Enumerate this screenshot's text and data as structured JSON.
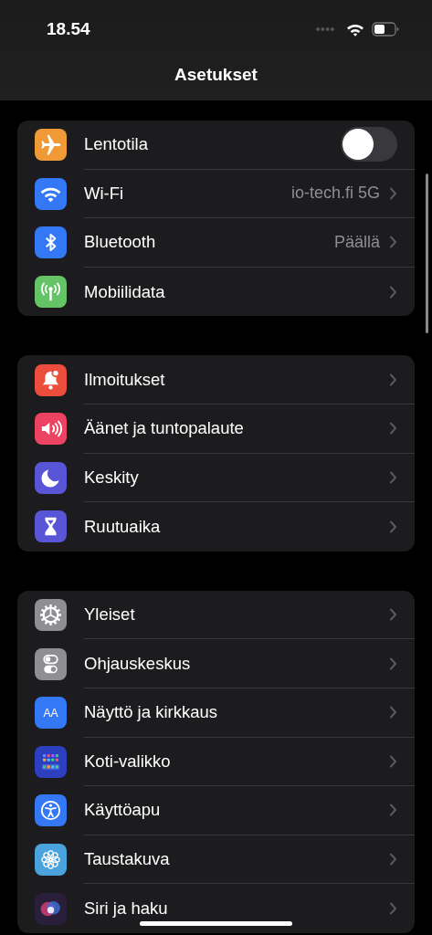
{
  "status_bar": {
    "time": "18.54"
  },
  "title": "Asetukset",
  "groups": [
    {
      "items": [
        {
          "kind": "toggle",
          "label": "Lentotila",
          "color": "#f09a37",
          "on": false
        },
        {
          "kind": "link",
          "label": "Wi-Fi",
          "value": "io-tech.fi 5G",
          "color": "#3478f6"
        },
        {
          "kind": "link",
          "label": "Bluetooth",
          "value": "Päällä",
          "color": "#3478f6"
        },
        {
          "kind": "link",
          "label": "Mobiilidata",
          "color": "#65c466"
        }
      ]
    },
    {
      "items": [
        {
          "kind": "link",
          "label": "Ilmoitukset",
          "color": "#eb4e3d"
        },
        {
          "kind": "link",
          "label": "Äänet ja tuntopalaute",
          "color": "#eb4361"
        },
        {
          "kind": "link",
          "label": "Keskity",
          "color": "#5856d6"
        },
        {
          "kind": "link",
          "label": "Ruutuaika",
          "color": "#5856d6"
        }
      ]
    },
    {
      "items": [
        {
          "kind": "link",
          "label": "Yleiset",
          "color": "#8e8e93"
        },
        {
          "kind": "link",
          "label": "Ohjauskeskus",
          "color": "#8e8e93"
        },
        {
          "kind": "link",
          "label": "Näyttö ja kirkkaus",
          "icon_text": "AA",
          "color": "#3478f6"
        },
        {
          "kind": "link",
          "label": "Koti-valikko",
          "color": "#2c3fbf"
        },
        {
          "kind": "link",
          "label": "Käyttöapu",
          "color": "#3478f6"
        },
        {
          "kind": "link",
          "label": "Taustakuva",
          "color": "#4aa3dd"
        },
        {
          "kind": "link",
          "label": "Siri ja haku",
          "color": "#2a1f3a"
        }
      ]
    }
  ]
}
